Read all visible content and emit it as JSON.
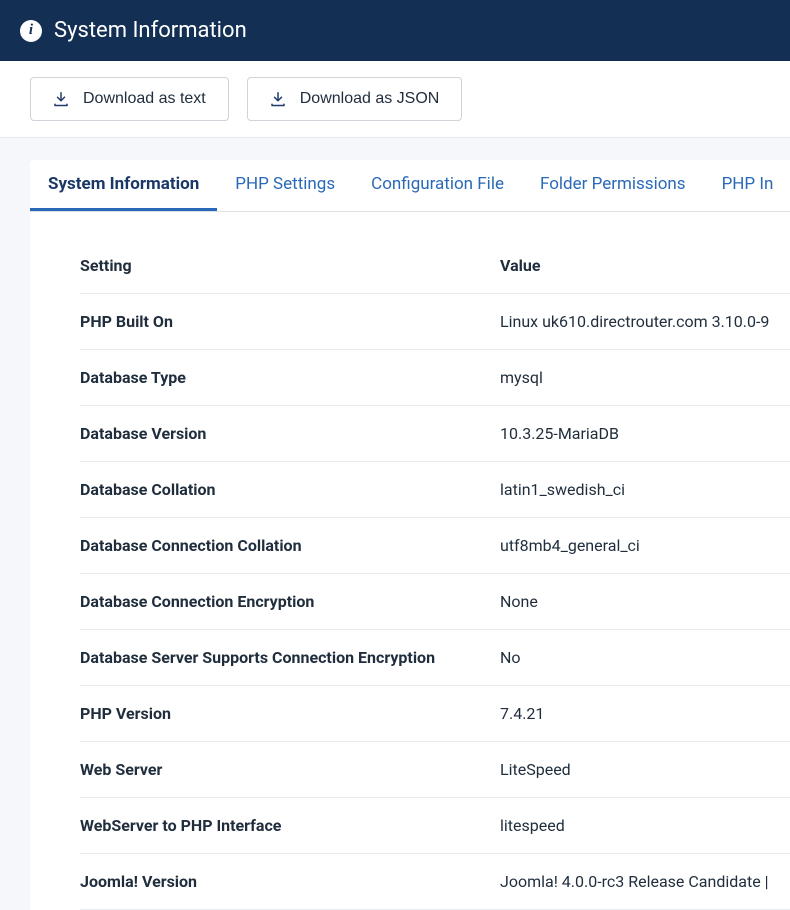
{
  "header": {
    "title": "System Information"
  },
  "toolbar": {
    "download_text_label": "Download as text",
    "download_json_label": "Download as JSON"
  },
  "tabs": [
    {
      "label": "System Information",
      "active": true
    },
    {
      "label": "PHP Settings",
      "active": false
    },
    {
      "label": "Configuration File",
      "active": false
    },
    {
      "label": "Folder Permissions",
      "active": false
    },
    {
      "label": "PHP In",
      "active": false
    }
  ],
  "table": {
    "headers": {
      "setting": "Setting",
      "value": "Value"
    },
    "rows": [
      {
        "setting": "PHP Built On",
        "value": "Linux uk610.directrouter.com 3.10.0-9"
      },
      {
        "setting": "Database Type",
        "value": "mysql"
      },
      {
        "setting": "Database Version",
        "value": "10.3.25-MariaDB"
      },
      {
        "setting": "Database Collation",
        "value": "latin1_swedish_ci"
      },
      {
        "setting": "Database Connection Collation",
        "value": "utf8mb4_general_ci"
      },
      {
        "setting": "Database Connection Encryption",
        "value": "None"
      },
      {
        "setting": "Database Server Supports Connection Encryption",
        "value": "No"
      },
      {
        "setting": "PHP Version",
        "value": "7.4.21"
      },
      {
        "setting": "Web Server",
        "value": "LiteSpeed"
      },
      {
        "setting": "WebServer to PHP Interface",
        "value": "litespeed"
      },
      {
        "setting": "Joomla! Version",
        "value": "Joomla! 4.0.0-rc3 Release Candidate |"
      }
    ]
  }
}
